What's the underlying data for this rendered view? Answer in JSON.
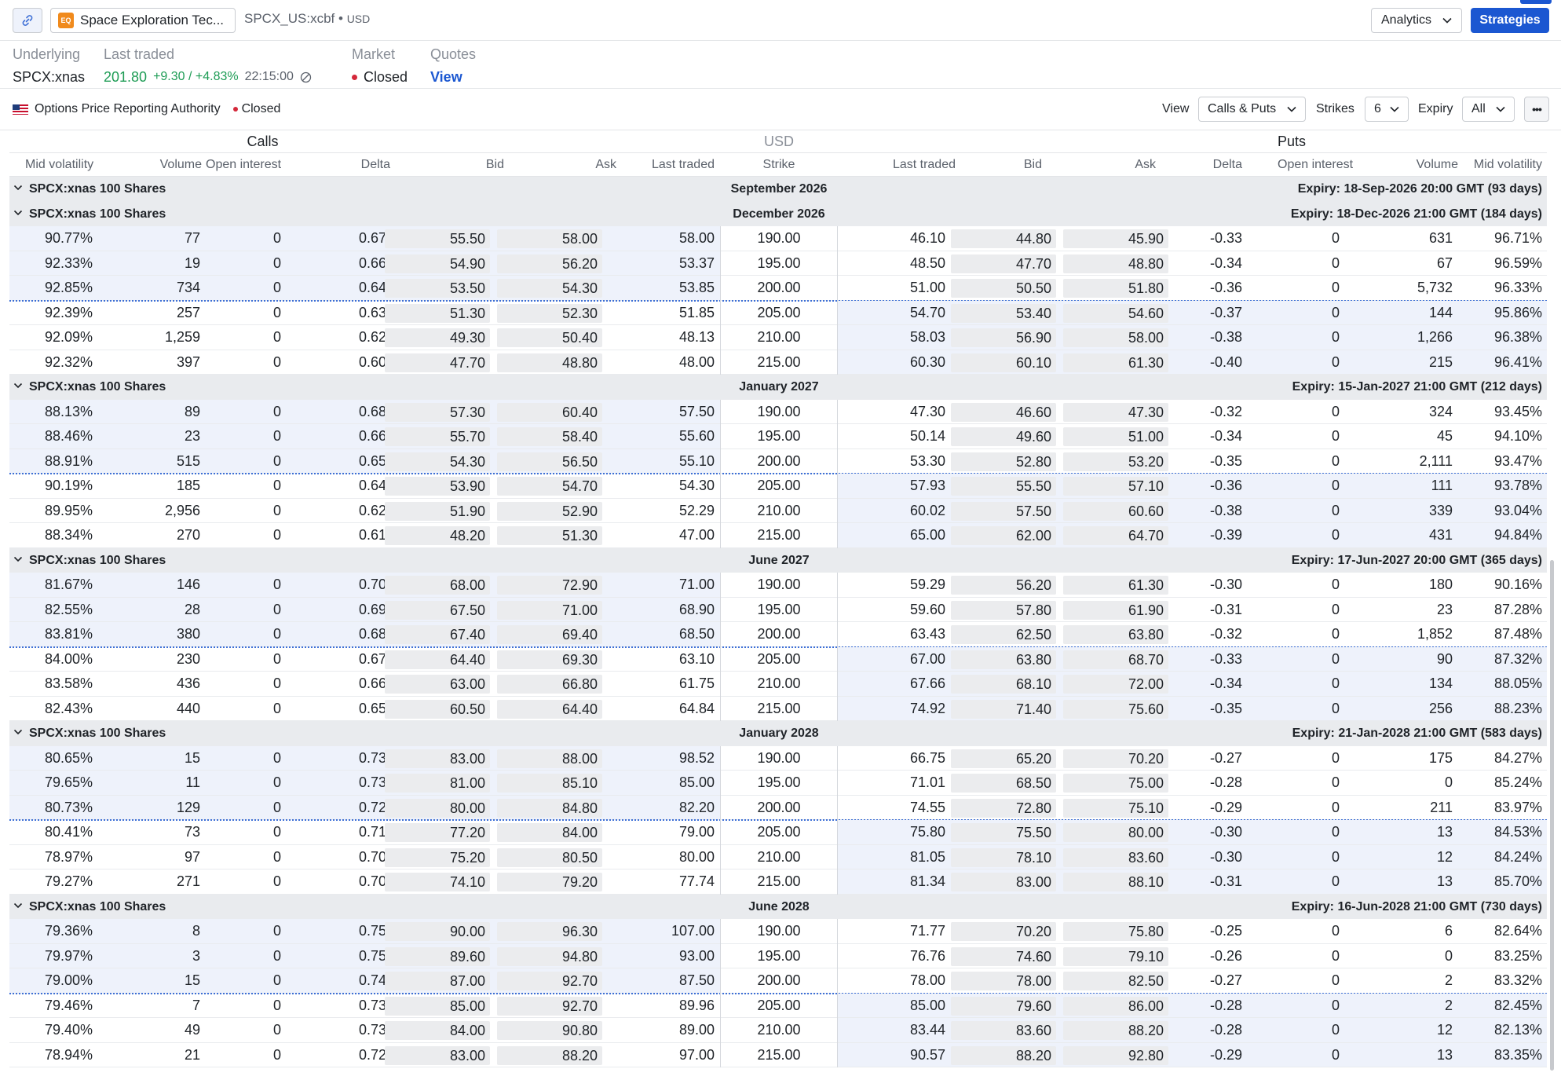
{
  "topbar": {
    "symbol_name": "Space Exploration Tec...",
    "ticker": "SPCX_US:xcbf",
    "currency": "USD",
    "analytics_label": "Analytics",
    "strategies_label": "Strategies"
  },
  "info": {
    "underlying_label": "Underlying",
    "underlying_value": "SPCX:xnas",
    "last_traded_label": "Last traded",
    "last_price": "201.80",
    "change": "+9.30 / +4.83%",
    "time": "22:15:00",
    "market_label": "Market",
    "market_status": "Closed",
    "quotes_label": "Quotes",
    "quotes_link": "View"
  },
  "toolbar": {
    "opra": "Options Price Reporting Authority",
    "opra_status": "Closed",
    "view_label": "View",
    "view_value": "Calls & Puts",
    "strikes_label": "Strikes",
    "strikes_value": "6",
    "expiry_label": "Expiry",
    "expiry_value": "All"
  },
  "table_header": {
    "calls": "Calls",
    "currency": "USD",
    "puts": "Puts",
    "columns": {
      "mid_vol": "Mid volatility",
      "volume": "Volume",
      "open_interest": "Open interest",
      "delta": "Delta",
      "bid": "Bid",
      "ask": "Ask",
      "last_traded": "Last traded",
      "strike": "Strike"
    }
  },
  "colors": {
    "accent": "#1b57d1",
    "green": "#1e9c55",
    "red": "#d4283a",
    "row_shade": "#eef2fb"
  },
  "groups": [
    {
      "underlying": "SPCX:xnas 100 Shares",
      "month": "September 2026",
      "expiry": "Expiry: 18-Sep-2026 20:00 GMT (93 days)",
      "rows": []
    },
    {
      "underlying": "SPCX:xnas 100 Shares",
      "month": "December 2026",
      "expiry": "Expiry: 18-Dec-2026 21:00 GMT (184 days)",
      "rows": [
        {
          "c_iv": "90.77%",
          "c_vol": "77",
          "c_oi": "0",
          "c_delta": "0.67",
          "c_bid": "55.50",
          "c_ask": "58.00",
          "c_last": "58.00",
          "strike": "190.00",
          "p_last": "46.10",
          "p_bid": "44.80",
          "p_ask": "45.90",
          "p_delta": "-0.33",
          "p_oi": "0",
          "p_vol": "631",
          "p_iv": "96.71%"
        },
        {
          "c_iv": "92.33%",
          "c_vol": "19",
          "c_oi": "0",
          "c_delta": "0.66",
          "c_bid": "54.90",
          "c_ask": "56.20",
          "c_last": "53.37",
          "strike": "195.00",
          "p_last": "48.50",
          "p_bid": "47.70",
          "p_ask": "48.80",
          "p_delta": "-0.34",
          "p_oi": "0",
          "p_vol": "67",
          "p_iv": "96.59%"
        },
        {
          "c_iv": "92.85%",
          "c_vol": "734",
          "c_oi": "0",
          "c_delta": "0.64",
          "c_bid": "53.50",
          "c_ask": "54.30",
          "c_last": "53.85",
          "strike": "200.00",
          "p_last": "51.00",
          "p_bid": "50.50",
          "p_ask": "51.80",
          "p_delta": "-0.36",
          "p_oi": "0",
          "p_vol": "5,732",
          "p_iv": "96.33%"
        },
        {
          "c_iv": "92.39%",
          "c_vol": "257",
          "c_oi": "0",
          "c_delta": "0.63",
          "c_bid": "51.30",
          "c_ask": "52.30",
          "c_last": "51.85",
          "strike": "205.00",
          "p_last": "54.70",
          "p_bid": "53.40",
          "p_ask": "54.60",
          "p_delta": "-0.37",
          "p_oi": "0",
          "p_vol": "144",
          "p_iv": "95.86%"
        },
        {
          "c_iv": "92.09%",
          "c_vol": "1,259",
          "c_oi": "0",
          "c_delta": "0.62",
          "c_bid": "49.30",
          "c_ask": "50.40",
          "c_last": "48.13",
          "strike": "210.00",
          "p_last": "58.03",
          "p_bid": "56.90",
          "p_ask": "58.00",
          "p_delta": "-0.38",
          "p_oi": "0",
          "p_vol": "1,266",
          "p_iv": "96.38%"
        },
        {
          "c_iv": "92.32%",
          "c_vol": "397",
          "c_oi": "0",
          "c_delta": "0.60",
          "c_bid": "47.70",
          "c_ask": "48.80",
          "c_last": "48.00",
          "strike": "215.00",
          "p_last": "60.30",
          "p_bid": "60.10",
          "p_ask": "61.30",
          "p_delta": "-0.40",
          "p_oi": "0",
          "p_vol": "215",
          "p_iv": "96.41%"
        }
      ]
    },
    {
      "underlying": "SPCX:xnas 100 Shares",
      "month": "January 2027",
      "expiry": "Expiry: 15-Jan-2027 21:00 GMT (212 days)",
      "rows": [
        {
          "c_iv": "88.13%",
          "c_vol": "89",
          "c_oi": "0",
          "c_delta": "0.68",
          "c_bid": "57.30",
          "c_ask": "60.40",
          "c_last": "57.50",
          "strike": "190.00",
          "p_last": "47.30",
          "p_bid": "46.60",
          "p_ask": "47.30",
          "p_delta": "-0.32",
          "p_oi": "0",
          "p_vol": "324",
          "p_iv": "93.45%"
        },
        {
          "c_iv": "88.46%",
          "c_vol": "23",
          "c_oi": "0",
          "c_delta": "0.66",
          "c_bid": "55.70",
          "c_ask": "58.40",
          "c_last": "55.60",
          "strike": "195.00",
          "p_last": "50.14",
          "p_bid": "49.60",
          "p_ask": "51.00",
          "p_delta": "-0.34",
          "p_oi": "0",
          "p_vol": "45",
          "p_iv": "94.10%"
        },
        {
          "c_iv": "88.91%",
          "c_vol": "515",
          "c_oi": "0",
          "c_delta": "0.65",
          "c_bid": "54.30",
          "c_ask": "56.50",
          "c_last": "55.10",
          "strike": "200.00",
          "p_last": "53.30",
          "p_bid": "52.80",
          "p_ask": "53.20",
          "p_delta": "-0.35",
          "p_oi": "0",
          "p_vol": "2,111",
          "p_iv": "93.47%"
        },
        {
          "c_iv": "90.19%",
          "c_vol": "185",
          "c_oi": "0",
          "c_delta": "0.64",
          "c_bid": "53.90",
          "c_ask": "54.70",
          "c_last": "54.30",
          "strike": "205.00",
          "p_last": "57.93",
          "p_bid": "55.50",
          "p_ask": "57.10",
          "p_delta": "-0.36",
          "p_oi": "0",
          "p_vol": "111",
          "p_iv": "93.78%"
        },
        {
          "c_iv": "89.95%",
          "c_vol": "2,956",
          "c_oi": "0",
          "c_delta": "0.62",
          "c_bid": "51.90",
          "c_ask": "52.90",
          "c_last": "52.29",
          "strike": "210.00",
          "p_last": "60.02",
          "p_bid": "57.50",
          "p_ask": "60.60",
          "p_delta": "-0.38",
          "p_oi": "0",
          "p_vol": "339",
          "p_iv": "93.04%"
        },
        {
          "c_iv": "88.34%",
          "c_vol": "270",
          "c_oi": "0",
          "c_delta": "0.61",
          "c_bid": "48.20",
          "c_ask": "51.30",
          "c_last": "47.00",
          "strike": "215.00",
          "p_last": "65.00",
          "p_bid": "62.00",
          "p_ask": "64.70",
          "p_delta": "-0.39",
          "p_oi": "0",
          "p_vol": "431",
          "p_iv": "94.84%"
        }
      ]
    },
    {
      "underlying": "SPCX:xnas 100 Shares",
      "month": "June 2027",
      "expiry": "Expiry: 17-Jun-2027 20:00 GMT (365 days)",
      "rows": [
        {
          "c_iv": "81.67%",
          "c_vol": "146",
          "c_oi": "0",
          "c_delta": "0.70",
          "c_bid": "68.00",
          "c_ask": "72.90",
          "c_last": "71.00",
          "strike": "190.00",
          "p_last": "59.29",
          "p_bid": "56.20",
          "p_ask": "61.30",
          "p_delta": "-0.30",
          "p_oi": "0",
          "p_vol": "180",
          "p_iv": "90.16%"
        },
        {
          "c_iv": "82.55%",
          "c_vol": "28",
          "c_oi": "0",
          "c_delta": "0.69",
          "c_bid": "67.50",
          "c_ask": "71.00",
          "c_last": "68.90",
          "strike": "195.00",
          "p_last": "59.60",
          "p_bid": "57.80",
          "p_ask": "61.90",
          "p_delta": "-0.31",
          "p_oi": "0",
          "p_vol": "23",
          "p_iv": "87.28%"
        },
        {
          "c_iv": "83.81%",
          "c_vol": "380",
          "c_oi": "0",
          "c_delta": "0.68",
          "c_bid": "67.40",
          "c_ask": "69.40",
          "c_last": "68.50",
          "strike": "200.00",
          "p_last": "63.43",
          "p_bid": "62.50",
          "p_ask": "63.80",
          "p_delta": "-0.32",
          "p_oi": "0",
          "p_vol": "1,852",
          "p_iv": "87.48%"
        },
        {
          "c_iv": "84.00%",
          "c_vol": "230",
          "c_oi": "0",
          "c_delta": "0.67",
          "c_bid": "64.40",
          "c_ask": "69.30",
          "c_last": "63.10",
          "strike": "205.00",
          "p_last": "67.00",
          "p_bid": "63.80",
          "p_ask": "68.70",
          "p_delta": "-0.33",
          "p_oi": "0",
          "p_vol": "90",
          "p_iv": "87.32%"
        },
        {
          "c_iv": "83.58%",
          "c_vol": "436",
          "c_oi": "0",
          "c_delta": "0.66",
          "c_bid": "63.00",
          "c_ask": "66.80",
          "c_last": "61.75",
          "strike": "210.00",
          "p_last": "67.66",
          "p_bid": "68.10",
          "p_ask": "72.00",
          "p_delta": "-0.34",
          "p_oi": "0",
          "p_vol": "134",
          "p_iv": "88.05%"
        },
        {
          "c_iv": "82.43%",
          "c_vol": "440",
          "c_oi": "0",
          "c_delta": "0.65",
          "c_bid": "60.50",
          "c_ask": "64.40",
          "c_last": "64.84",
          "strike": "215.00",
          "p_last": "74.92",
          "p_bid": "71.40",
          "p_ask": "75.60",
          "p_delta": "-0.35",
          "p_oi": "0",
          "p_vol": "256",
          "p_iv": "88.23%"
        }
      ]
    },
    {
      "underlying": "SPCX:xnas 100 Shares",
      "month": "January 2028",
      "expiry": "Expiry: 21-Jan-2028 21:00 GMT (583 days)",
      "rows": [
        {
          "c_iv": "80.65%",
          "c_vol": "15",
          "c_oi": "0",
          "c_delta": "0.73",
          "c_bid": "83.00",
          "c_ask": "88.00",
          "c_last": "98.52",
          "strike": "190.00",
          "p_last": "66.75",
          "p_bid": "65.20",
          "p_ask": "70.20",
          "p_delta": "-0.27",
          "p_oi": "0",
          "p_vol": "175",
          "p_iv": "84.27%"
        },
        {
          "c_iv": "79.65%",
          "c_vol": "11",
          "c_oi": "0",
          "c_delta": "0.73",
          "c_bid": "81.00",
          "c_ask": "85.10",
          "c_last": "85.00",
          "strike": "195.00",
          "p_last": "71.01",
          "p_bid": "68.50",
          "p_ask": "75.00",
          "p_delta": "-0.28",
          "p_oi": "0",
          "p_vol": "0",
          "p_iv": "85.24%"
        },
        {
          "c_iv": "80.73%",
          "c_vol": "129",
          "c_oi": "0",
          "c_delta": "0.72",
          "c_bid": "80.00",
          "c_ask": "84.80",
          "c_last": "82.20",
          "strike": "200.00",
          "p_last": "74.55",
          "p_bid": "72.80",
          "p_ask": "75.10",
          "p_delta": "-0.29",
          "p_oi": "0",
          "p_vol": "211",
          "p_iv": "83.97%"
        },
        {
          "c_iv": "80.41%",
          "c_vol": "73",
          "c_oi": "0",
          "c_delta": "0.71",
          "c_bid": "77.20",
          "c_ask": "84.00",
          "c_last": "79.00",
          "strike": "205.00",
          "p_last": "75.80",
          "p_bid": "75.50",
          "p_ask": "80.00",
          "p_delta": "-0.30",
          "p_oi": "0",
          "p_vol": "13",
          "p_iv": "84.53%"
        },
        {
          "c_iv": "78.97%",
          "c_vol": "97",
          "c_oi": "0",
          "c_delta": "0.70",
          "c_bid": "75.20",
          "c_ask": "80.50",
          "c_last": "80.00",
          "strike": "210.00",
          "p_last": "81.05",
          "p_bid": "78.10",
          "p_ask": "83.60",
          "p_delta": "-0.30",
          "p_oi": "0",
          "p_vol": "12",
          "p_iv": "84.24%"
        },
        {
          "c_iv": "79.27%",
          "c_vol": "271",
          "c_oi": "0",
          "c_delta": "0.70",
          "c_bid": "74.10",
          "c_ask": "79.20",
          "c_last": "77.74",
          "strike": "215.00",
          "p_last": "81.34",
          "p_bid": "83.00",
          "p_ask": "88.10",
          "p_delta": "-0.31",
          "p_oi": "0",
          "p_vol": "13",
          "p_iv": "85.70%"
        }
      ]
    },
    {
      "underlying": "SPCX:xnas 100 Shares",
      "month": "June 2028",
      "expiry": "Expiry: 16-Jun-2028 21:00 GMT (730 days)",
      "rows": [
        {
          "c_iv": "79.36%",
          "c_vol": "8",
          "c_oi": "0",
          "c_delta": "0.75",
          "c_bid": "90.00",
          "c_ask": "96.30",
          "c_last": "107.00",
          "strike": "190.00",
          "p_last": "71.77",
          "p_bid": "70.20",
          "p_ask": "75.80",
          "p_delta": "-0.25",
          "p_oi": "0",
          "p_vol": "6",
          "p_iv": "82.64%"
        },
        {
          "c_iv": "79.97%",
          "c_vol": "3",
          "c_oi": "0",
          "c_delta": "0.75",
          "c_bid": "89.60",
          "c_ask": "94.80",
          "c_last": "93.00",
          "strike": "195.00",
          "p_last": "76.76",
          "p_bid": "74.60",
          "p_ask": "79.10",
          "p_delta": "-0.26",
          "p_oi": "0",
          "p_vol": "0",
          "p_iv": "83.25%"
        },
        {
          "c_iv": "79.00%",
          "c_vol": "15",
          "c_oi": "0",
          "c_delta": "0.74",
          "c_bid": "87.00",
          "c_ask": "92.70",
          "c_last": "87.50",
          "strike": "200.00",
          "p_last": "78.00",
          "p_bid": "78.00",
          "p_ask": "82.50",
          "p_delta": "-0.27",
          "p_oi": "0",
          "p_vol": "2",
          "p_iv": "83.32%"
        },
        {
          "c_iv": "79.46%",
          "c_vol": "7",
          "c_oi": "0",
          "c_delta": "0.73",
          "c_bid": "85.00",
          "c_ask": "92.70",
          "c_last": "89.96",
          "strike": "205.00",
          "p_last": "85.00",
          "p_bid": "79.60",
          "p_ask": "86.00",
          "p_delta": "-0.28",
          "p_oi": "0",
          "p_vol": "2",
          "p_iv": "82.45%"
        },
        {
          "c_iv": "79.40%",
          "c_vol": "49",
          "c_oi": "0",
          "c_delta": "0.73",
          "c_bid": "84.00",
          "c_ask": "90.80",
          "c_last": "89.00",
          "strike": "210.00",
          "p_last": "83.44",
          "p_bid": "83.60",
          "p_ask": "88.20",
          "p_delta": "-0.28",
          "p_oi": "0",
          "p_vol": "12",
          "p_iv": "82.13%"
        },
        {
          "c_iv": "78.94%",
          "c_vol": "21",
          "c_oi": "0",
          "c_delta": "0.72",
          "c_bid": "83.00",
          "c_ask": "88.20",
          "c_last": "97.00",
          "strike": "215.00",
          "p_last": "90.57",
          "p_bid": "88.20",
          "p_ask": "92.80",
          "p_delta": "-0.29",
          "p_oi": "0",
          "p_vol": "13",
          "p_iv": "83.35%"
        }
      ]
    }
  ]
}
